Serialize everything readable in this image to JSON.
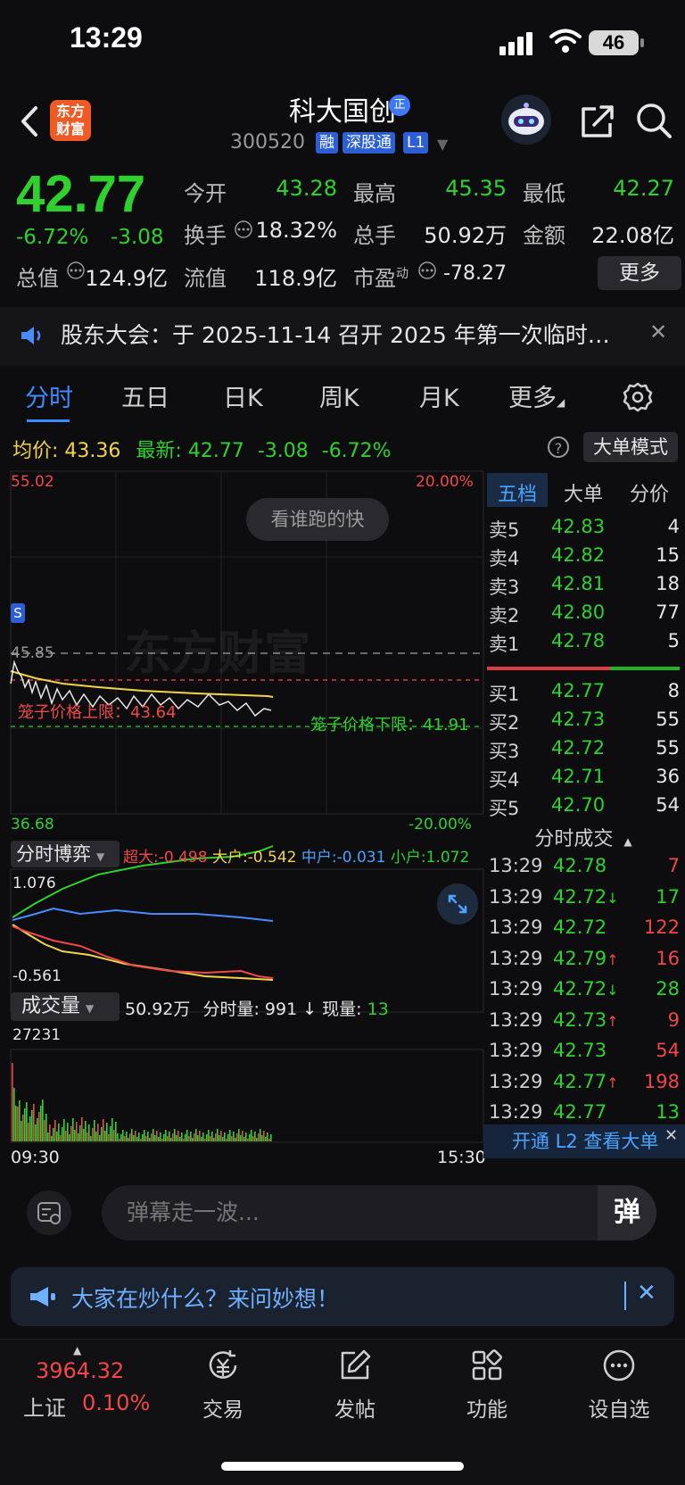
{
  "status_bar": {
    "time": "13:29",
    "battery": "46"
  },
  "header": {
    "logo_text_1": "东方",
    "logo_text_2": "财富",
    "stock_name": "科大国创",
    "verify_badge": "正",
    "stock_code": "300520",
    "tags": [
      "融",
      "深股通",
      "L1"
    ]
  },
  "quote": {
    "last_price": "42.77",
    "change_pct": "-6.72%",
    "change": "-3.08",
    "fields": [
      {
        "label": "今开",
        "value": "43.28",
        "color": "#2fd12f"
      },
      {
        "label": "最高",
        "value": "45.35",
        "color": "#2fd12f"
      },
      {
        "label": "最低",
        "value": "42.27",
        "color": "#2fd12f"
      },
      {
        "label": "换手",
        "value": "18.32%",
        "color": "#e6e6e6"
      },
      {
        "label": "总手",
        "value": "50.92万",
        "color": "#e6e6e6"
      },
      {
        "label": "金额",
        "value": "22.08亿",
        "color": "#e6e6e6"
      },
      {
        "label": "总值",
        "value": "124.9亿",
        "color": "#e6e6e6"
      },
      {
        "label": "流值",
        "value": "118.9亿",
        "color": "#e6e6e6"
      },
      {
        "label": "市盈",
        "label_sup": "动",
        "value": "-78.27",
        "color": "#e6e6e6"
      }
    ],
    "more_label": "更多"
  },
  "notice": {
    "text": "股东大会：于 2025-11-14 召开 2025 年第一次临时…"
  },
  "tabs": [
    "分时",
    "五日",
    "日K",
    "周K",
    "月K",
    "更多"
  ],
  "avg_row": {
    "avg_label": "均价:",
    "avg_value": "43.36",
    "latest_label": "最新:",
    "latest_value": "42.77",
    "change": "-3.08",
    "change_pct": "-6.72%",
    "big_order_mode": "大单模式"
  },
  "chart": {
    "y_top": "55.02",
    "y_top_pct": "20.00%",
    "y_bottom": "36.68",
    "y_bottom_pct": "-20.00%",
    "prev_close_label": "45.85",
    "upper_cage": "笼子价格上限：43.64",
    "lower_cage": "笼子价格下限：41.91",
    "bubble": "看谁跑的快",
    "watermark": "东方财富",
    "s_marker": "S",
    "time_start": "09:30",
    "time_end": "15:30"
  },
  "bobi": {
    "button": "分时博弈",
    "super_label": "超大:",
    "super_value": "-0.498",
    "big_label": "大户:",
    "big_value": "-0.542",
    "mid_label": "中户:",
    "mid_value": "-0.031",
    "small_label": "小户:",
    "small_value": "1.072",
    "y_top": "1.076",
    "y_bottom": "-0.561",
    "colors": {
      "super": "#f04848",
      "big": "#f2d34a",
      "mid": "#4a8cff",
      "small": "#2fd12f"
    }
  },
  "volume": {
    "button": "成交量",
    "total": "50.92万",
    "interval_label": "分时量:",
    "interval_value": "991",
    "current_label": "现量:",
    "current_value": "13",
    "y_top": "27231"
  },
  "order_book": {
    "tabs": [
      "五档",
      "大单",
      "分价"
    ],
    "asks": [
      {
        "label": "卖5",
        "price": "42.83",
        "volume": "4"
      },
      {
        "label": "卖4",
        "price": "42.82",
        "volume": "15"
      },
      {
        "label": "卖3",
        "price": "42.81",
        "volume": "18"
      },
      {
        "label": "卖2",
        "price": "42.80",
        "volume": "77"
      },
      {
        "label": "卖1",
        "price": "42.78",
        "volume": "5"
      }
    ],
    "bids": [
      {
        "label": "买1",
        "price": "42.77",
        "volume": "8"
      },
      {
        "label": "买2",
        "price": "42.73",
        "volume": "55"
      },
      {
        "label": "买3",
        "price": "42.72",
        "volume": "55"
      },
      {
        "label": "买4",
        "price": "42.71",
        "volume": "36"
      },
      {
        "label": "买5",
        "price": "42.70",
        "volume": "54"
      }
    ]
  },
  "trades": {
    "title": "分时成交",
    "rows": [
      {
        "time": "13:29",
        "price": "42.78",
        "arrow": "",
        "volume": "7",
        "pcolor": "#2fd12f",
        "vcolor": "#f04848"
      },
      {
        "time": "13:29",
        "price": "42.72",
        "arrow": "↓",
        "volume": "17",
        "pcolor": "#2fd12f",
        "vcolor": "#2fd12f"
      },
      {
        "time": "13:29",
        "price": "42.72",
        "arrow": "",
        "volume": "122",
        "pcolor": "#2fd12f",
        "vcolor": "#f04848"
      },
      {
        "time": "13:29",
        "price": "42.79",
        "arrow": "↑",
        "volume": "16",
        "pcolor": "#2fd12f",
        "vcolor": "#f04848"
      },
      {
        "time": "13:29",
        "price": "42.72",
        "arrow": "↓",
        "volume": "28",
        "pcolor": "#2fd12f",
        "vcolor": "#2fd12f"
      },
      {
        "time": "13:29",
        "price": "42.73",
        "arrow": "↑",
        "volume": "9",
        "pcolor": "#2fd12f",
        "vcolor": "#f04848"
      },
      {
        "time": "13:29",
        "price": "42.73",
        "arrow": "",
        "volume": "54",
        "pcolor": "#2fd12f",
        "vcolor": "#f04848"
      },
      {
        "time": "13:29",
        "price": "42.77",
        "arrow": "↑",
        "volume": "198",
        "pcolor": "#2fd12f",
        "vcolor": "#f04848"
      },
      {
        "time": "13:29",
        "price": "42.77",
        "arrow": "",
        "volume": "13",
        "pcolor": "#2fd12f",
        "vcolor": "#2fd12f"
      }
    ],
    "l2_bar": "开通 L2 查看大单"
  },
  "danmaku": {
    "placeholder": "弹幕走一波...",
    "send": "弹"
  },
  "ask_banner": {
    "text": "大家在炒什么？来问妙想！"
  },
  "bottom_nav": {
    "index_value": "3964.32",
    "index_name": "上证",
    "index_pct": "0.10%",
    "items": [
      "交易",
      "发帖",
      "功能",
      "设自选"
    ]
  }
}
